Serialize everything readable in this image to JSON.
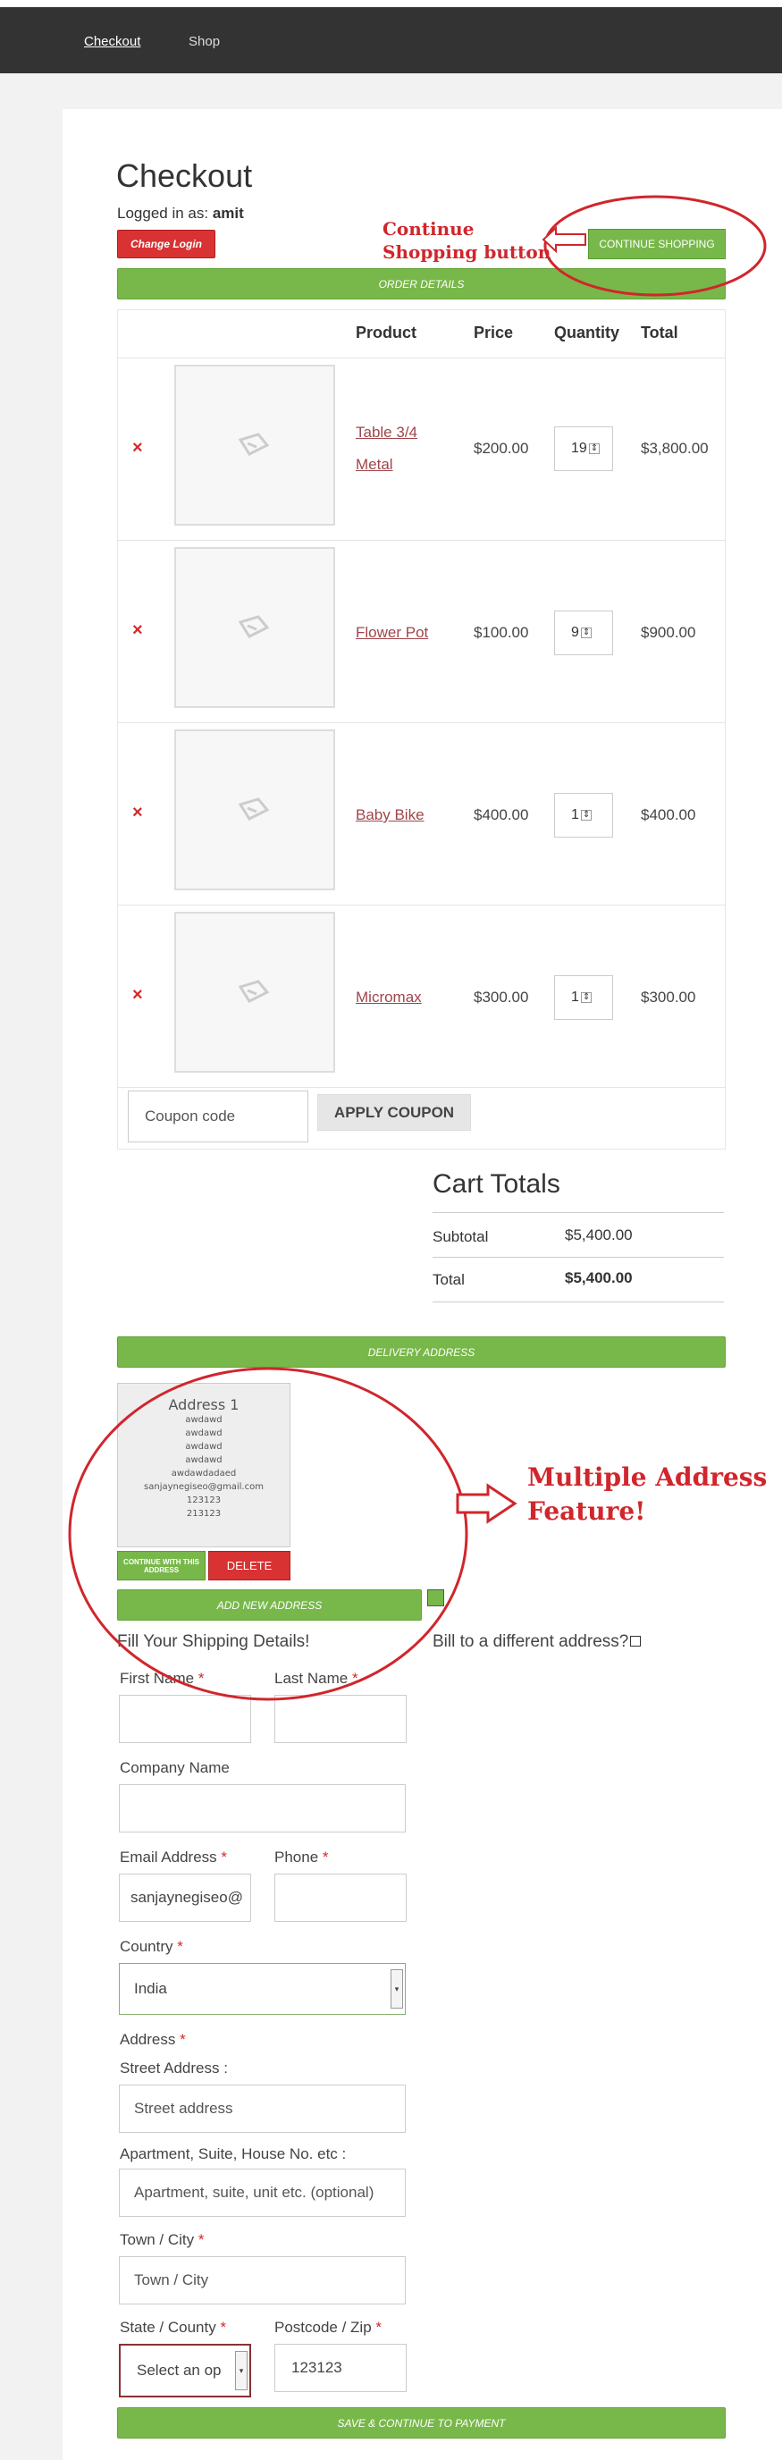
{
  "nav": {
    "checkout": "Checkout",
    "shop": "Shop"
  },
  "page": {
    "title": "Checkout",
    "logged_in_label": "Logged in as:",
    "username": "amit",
    "change_login": "Change Login",
    "continue_shopping": "CONTINUE SHOPPING",
    "order_details_bar": "ORDER DETAILS"
  },
  "table": {
    "headers": [
      "Product",
      "Price",
      "Quantity",
      "Total"
    ],
    "rows": [
      {
        "name": "Table 3/4 Metal",
        "price": "$200.00",
        "qty": "19",
        "total": "$3,800.00"
      },
      {
        "name": "Flower Pot",
        "price": "$100.00",
        "qty": "9",
        "total": "$900.00"
      },
      {
        "name": "Baby Bike",
        "price": "$400.00",
        "qty": "1",
        "total": "$400.00"
      },
      {
        "name": "Micromax",
        "price": "$300.00",
        "qty": "1",
        "total": "$300.00"
      }
    ],
    "remove_icon": "×"
  },
  "coupon": {
    "placeholder": "Coupon code",
    "apply": "APPLY COUPON"
  },
  "cart_totals": {
    "title": "Cart Totals",
    "subtotal_label": "Subtotal",
    "subtotal_value": "$5,400.00",
    "total_label": "Total",
    "total_value": "$5,400.00"
  },
  "delivery": {
    "bar": "DELIVERY ADDRESS",
    "address_card": {
      "title": "Address 1",
      "lines": [
        "awdawd",
        "awdawd",
        "awdawd",
        "awdawd",
        "awdawdadaed",
        "sanjaynegiseo@gmail.com",
        "123123",
        "213123"
      ]
    },
    "continue_with": "CONTINUE WITH THIS ADDRESS",
    "delete": "DELETE",
    "add_new": "ADD NEW ADDRESS"
  },
  "shipping": {
    "title": "Fill Your Shipping Details!",
    "bill_to_diff": "Bill to a different address?",
    "first_name": "First Name",
    "last_name": "Last Name",
    "company": "Company Name",
    "email": "Email Address",
    "email_value": "sanjaynegiseo@",
    "phone": "Phone",
    "country": "Country",
    "country_value": "India",
    "address": "Address",
    "street_label": "Street Address :",
    "street_placeholder": "Street address",
    "apt_label": "Apartment, Suite, House No. etc :",
    "apt_placeholder": "Apartment, suite, unit etc. (optional)",
    "town": "Town / City",
    "town_placeholder": "Town / City",
    "state": "State / County",
    "state_value": "Select an op",
    "postcode": "Postcode / Zip",
    "postcode_value": "123123",
    "required_mark": "*",
    "save_continue": "SAVE & CONTINUE TO PAYMENT"
  },
  "annotations": {
    "continue_shopping_note_1": "Continue",
    "continue_shopping_note_2": "Shopping button",
    "multiple_address_1": "Multiple Address",
    "multiple_address_2": "Feature!"
  },
  "colors": {
    "green": "#78b84a",
    "red": "#d83232",
    "annotation": "#d0262c",
    "link": "#a0454a"
  }
}
